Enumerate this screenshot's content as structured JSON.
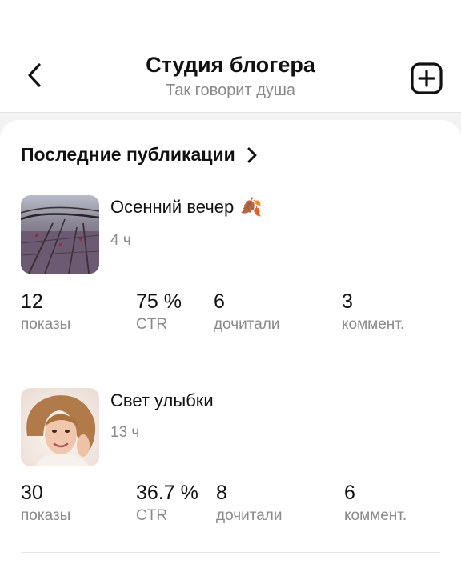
{
  "header": {
    "title": "Студия блогера",
    "subtitle": "Так говорит душа"
  },
  "section": {
    "title": "Последние публикации"
  },
  "publications": [
    {
      "title": "Осенний вечер",
      "emoji": "🍂",
      "time": "4 ч",
      "stats": [
        {
          "value": "12",
          "label": "показы"
        },
        {
          "value": "75 %",
          "label": "CTR"
        },
        {
          "value": "6",
          "label": "дочитали"
        },
        {
          "value": "3",
          "label": "коммент."
        }
      ]
    },
    {
      "title": "Свет улыбки",
      "time": "13 ч",
      "stats": [
        {
          "value": "30",
          "label": "показы"
        },
        {
          "value": "36.7 %",
          "label": "CTR"
        },
        {
          "value": "8",
          "label": "дочитали"
        },
        {
          "value": "6",
          "label": "коммент."
        }
      ]
    }
  ],
  "icons": {
    "back": "chevron-left-icon",
    "add": "add-square-icon",
    "section_arrow": "chevron-right-icon"
  }
}
